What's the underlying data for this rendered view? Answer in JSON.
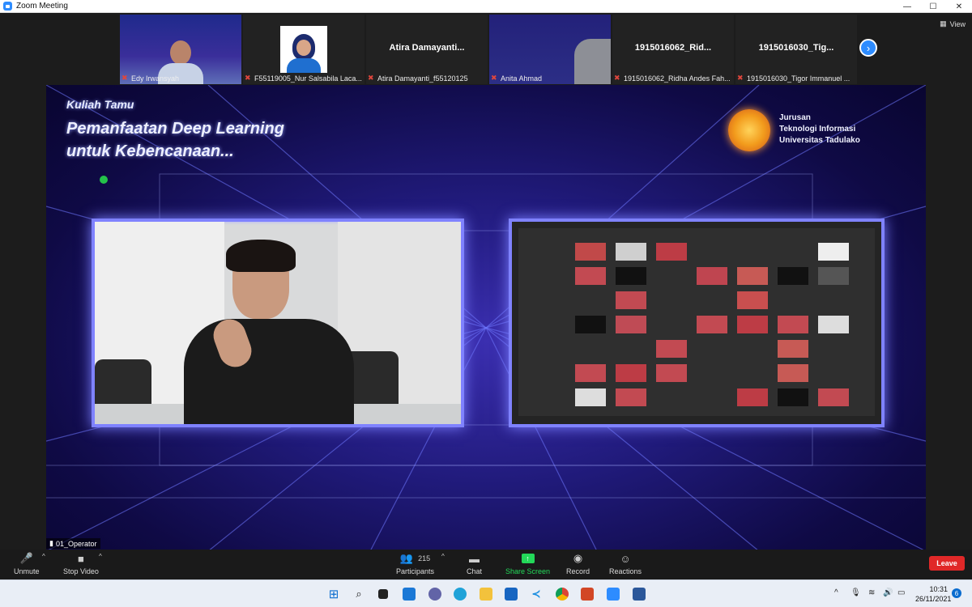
{
  "window": {
    "title": "Zoom Meeting",
    "controls": [
      "—",
      "☐",
      "✕"
    ]
  },
  "filmstrip": {
    "participants": [
      {
        "name": "Edy Irwansyah",
        "label": ""
      },
      {
        "name": "F55119005_Nur Salsabila Laca...",
        "label": ""
      },
      {
        "name": "Atira Damayanti_f55120125",
        "label": "Atira  Damayanti..."
      },
      {
        "name": "Anita Ahmad",
        "label": ""
      },
      {
        "name": "1915016062_Ridha Andes Fah...",
        "label": "1915016062_Rid..."
      },
      {
        "name": "1915016030_Tigor Immanuel ...",
        "label": "1915016030_Tig..."
      }
    ],
    "view_label": "View",
    "next_icon": "chevron-right-icon"
  },
  "shared_screen": {
    "kuliah": "Kuliah Tamu",
    "headline_line1": "Pemanfaatan Deep Learning",
    "headline_line2": "untuk Kebencanaan...",
    "institution_line1": "Jurusan",
    "institution_line2": "Teknologi Informasi",
    "institution_line3": "Universitas Tadulako",
    "operator_label": "01_Operator"
  },
  "toolbar": {
    "unmute": "Unmute",
    "stop_video": "Stop Video",
    "participants": "Participants",
    "participants_count": "215",
    "chat": "Chat",
    "share_screen": "Share Screen",
    "record": "Record",
    "reactions": "Reactions",
    "leave": "Leave"
  },
  "taskbar": {
    "time": "10:31",
    "date": "26/11/2021",
    "notifications": "6"
  },
  "colors": {
    "zoom_blue": "#2d8cff",
    "leave_red": "#e02828",
    "share_green": "#23d959",
    "slide_purple": "#3b2fb0"
  }
}
